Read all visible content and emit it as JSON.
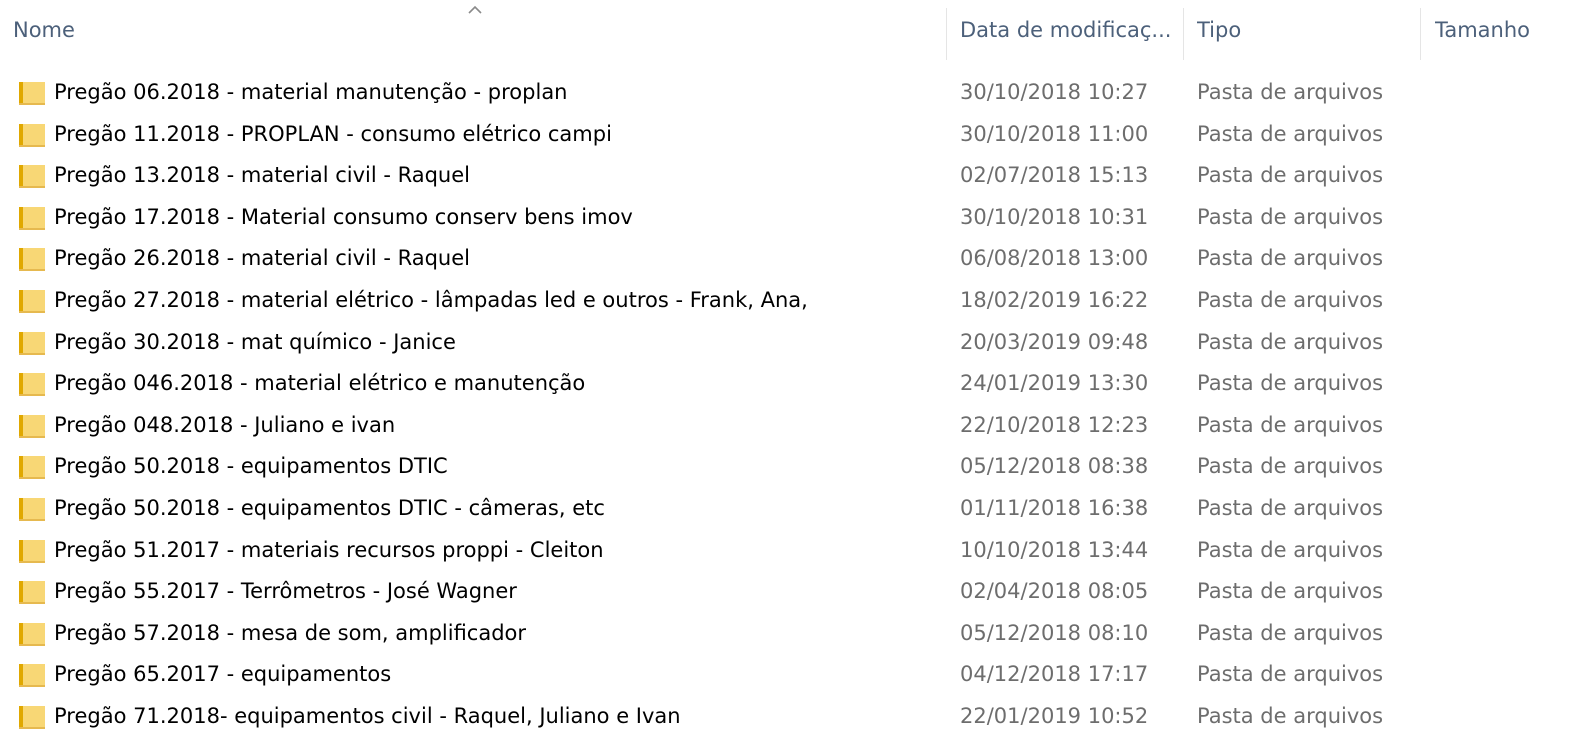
{
  "header": {
    "columns": {
      "name": "Nome",
      "modified": "Data de modificaç...",
      "type": "Tipo",
      "size": "Tamanho"
    },
    "sort_indicator": "chevron-up-icon"
  },
  "colors": {
    "header_text": "#4c607a",
    "secondary_text": "#6d6d6d",
    "folder_yellow": "#f8d775",
    "folder_dark": "#e0a800"
  },
  "rows": [
    {
      "name": "Pregão 06.2018 - material manutenção - proplan",
      "modified": "30/10/2018 10:27",
      "type": "Pasta de arquivos",
      "size": ""
    },
    {
      "name": "Pregão 11.2018 - PROPLAN - consumo elétrico campi",
      "modified": "30/10/2018 11:00",
      "type": "Pasta de arquivos",
      "size": ""
    },
    {
      "name": "Pregão 13.2018 - material civil - Raquel",
      "modified": "02/07/2018 15:13",
      "type": "Pasta de arquivos",
      "size": ""
    },
    {
      "name": "Pregão 17.2018 - Material consumo conserv bens imov",
      "modified": "30/10/2018 10:31",
      "type": "Pasta de arquivos",
      "size": ""
    },
    {
      "name": "Pregão 26.2018 - material civil - Raquel",
      "modified": "06/08/2018 13:00",
      "type": "Pasta de arquivos",
      "size": ""
    },
    {
      "name": "Pregão 27.2018 - material elétrico - lâmpadas led e outros - Frank, Ana,",
      "modified": "18/02/2019 16:22",
      "type": "Pasta de arquivos",
      "size": ""
    },
    {
      "name": "Pregão 30.2018 - mat químico - Janice",
      "modified": "20/03/2019 09:48",
      "type": "Pasta de arquivos",
      "size": ""
    },
    {
      "name": "Pregão 046.2018 - material elétrico e manutenção",
      "modified": "24/01/2019 13:30",
      "type": "Pasta de arquivos",
      "size": ""
    },
    {
      "name": "Pregão 048.2018 - Juliano e ivan",
      "modified": "22/10/2018 12:23",
      "type": "Pasta de arquivos",
      "size": ""
    },
    {
      "name": "Pregão 50.2018 - equipamentos DTIC",
      "modified": "05/12/2018 08:38",
      "type": "Pasta de arquivos",
      "size": ""
    },
    {
      "name": "Pregão 50.2018 - equipamentos DTIC - câmeras, etc",
      "modified": "01/11/2018 16:38",
      "type": "Pasta de arquivos",
      "size": ""
    },
    {
      "name": "Pregão 51.2017 - materiais recursos proppi - Cleiton",
      "modified": "10/10/2018 13:44",
      "type": "Pasta de arquivos",
      "size": ""
    },
    {
      "name": "Pregão 55.2017 - Terrômetros - José Wagner",
      "modified": "02/04/2018 08:05",
      "type": "Pasta de arquivos",
      "size": ""
    },
    {
      "name": "Pregão 57.2018 - mesa de som, amplificador",
      "modified": "05/12/2018 08:10",
      "type": "Pasta de arquivos",
      "size": ""
    },
    {
      "name": "Pregão 65.2017 - equipamentos",
      "modified": "04/12/2018 17:17",
      "type": "Pasta de arquivos",
      "size": ""
    },
    {
      "name": "Pregão 71.2018- equipamentos civil - Raquel, Juliano e Ivan",
      "modified": "22/01/2019 10:52",
      "type": "Pasta de arquivos",
      "size": ""
    }
  ]
}
